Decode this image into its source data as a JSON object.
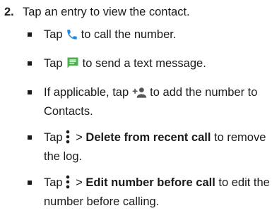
{
  "step": {
    "number": "2.",
    "text": "Tap an entry to view the contact."
  },
  "items": [
    {
      "before": "Tap",
      "icon": "phone-icon",
      "after": "to call the number."
    },
    {
      "before": "Tap",
      "icon": "message-icon",
      "after": "to send a text message."
    },
    {
      "before": "If applicable, tap",
      "icon": "add-contact-icon",
      "after": "to add the number to Contacts."
    },
    {
      "before": "Tap",
      "icon": "more-options-icon",
      "sep": " > ",
      "bold": "Delete from recent call",
      "after": " to remove the log."
    },
    {
      "before": "Tap",
      "icon": "more-options-icon",
      "sep": " > ",
      "bold": "Edit number before call",
      "after": " to edit the number before calling."
    }
  ],
  "colors": {
    "phone_icon": "#1e88e5",
    "message_icon": "#4caf50",
    "icon_gray": "#555555",
    "text": "#1a1a1a"
  }
}
